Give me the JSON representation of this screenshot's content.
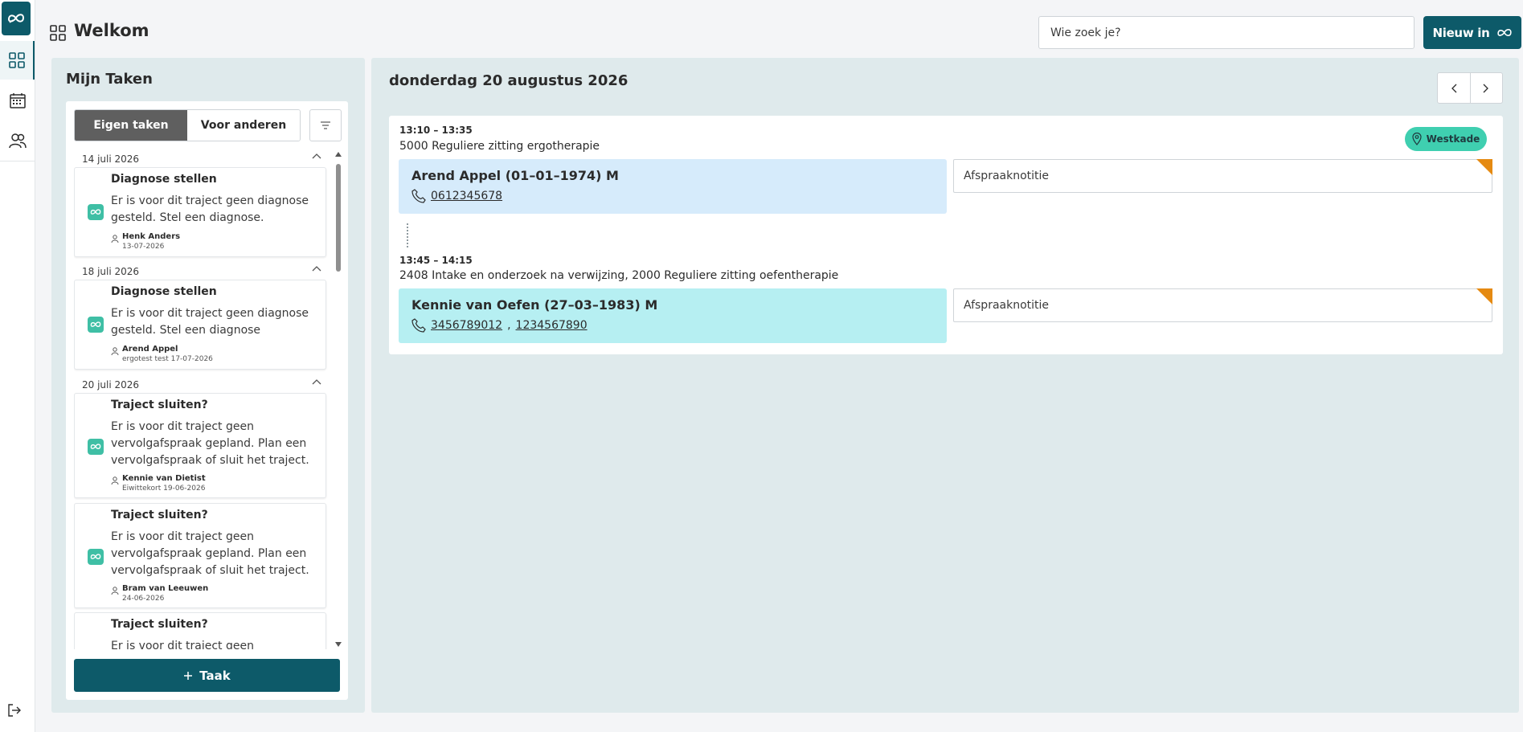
{
  "header": {
    "title": "Welkom",
    "search_placeholder": "Wie zoek je?",
    "new_button_label": "Nieuw in"
  },
  "nav": {
    "items": [
      {
        "name": "dashboard",
        "icon": "grid-icon",
        "active": true
      },
      {
        "name": "calendar",
        "icon": "calendar-icon",
        "active": false
      },
      {
        "name": "clients",
        "icon": "people-icon",
        "active": false
      }
    ],
    "logout_icon": "logout-icon"
  },
  "tasks": {
    "title": "Mijn Taken",
    "tabs": [
      {
        "label": "Eigen taken",
        "selected": true
      },
      {
        "label": "Voor anderen",
        "selected": false
      }
    ],
    "groups": [
      {
        "date": "14 juli 2026",
        "cards": [
          {
            "title": "Diagnose stellen",
            "body": "Er is voor dit traject geen diagnose gesteld. Stel een diagnose.",
            "person": "Henk Anders",
            "meta": "13-07-2026"
          }
        ]
      },
      {
        "date": "18 juli 2026",
        "cards": [
          {
            "title": "Diagnose stellen",
            "body": "Er is voor dit traject geen diagnose gesteld. Stel een diagnose",
            "person": "Arend Appel",
            "meta": "ergotest test 17-07-2026"
          }
        ]
      },
      {
        "date": "20 juli 2026",
        "cards": [
          {
            "title": "Traject sluiten?",
            "body": "Er is voor dit traject geen vervolgafspraak gepland. Plan een vervolgafspraak of sluit het traject.",
            "person": "Kennie van Dietist",
            "meta": "Eiwittekort 19-06-2026"
          },
          {
            "title": "Traject sluiten?",
            "body": "Er is voor dit traject geen vervolgafspraak gepland. Plan een vervolgafspraak of sluit het traject.",
            "person": "Bram van Leeuwen",
            "meta": "24-06-2026"
          },
          {
            "title": "Traject sluiten?",
            "body": "Er is voor dit traject geen",
            "person": "",
            "meta": ""
          }
        ]
      }
    ],
    "add_button_label": "Taak"
  },
  "agenda": {
    "date": "donderdag 20 augustus 2026",
    "location": "Westkade",
    "appointments": [
      {
        "time": "13:10 – 13:35",
        "description": "5000 Reguliere zitting ergotherapie",
        "patient": "Arend Appel (01–01–1974) M",
        "phones": [
          "0612345678"
        ],
        "note_placeholder": "Afspraaknotitie"
      },
      {
        "time": "13:45 – 14:15",
        "description": "2408 Intake en onderzoek na verwijzing, 2000 Reguliere zitting oefentherapie",
        "patient": "Kennie van Oefen (27–03–1983) M",
        "phones": [
          "3456789012",
          "1234567890"
        ],
        "note_placeholder": "Afspraaknotitie"
      }
    ]
  },
  "colors": {
    "brand": "#0d5a69",
    "task_icon": "#3fbfa5",
    "location_badge": "#3fcfb0",
    "note_flag": "#e58a12",
    "patient_1_bg": "#d6ebfb",
    "patient_2_bg": "#b6eff2"
  }
}
